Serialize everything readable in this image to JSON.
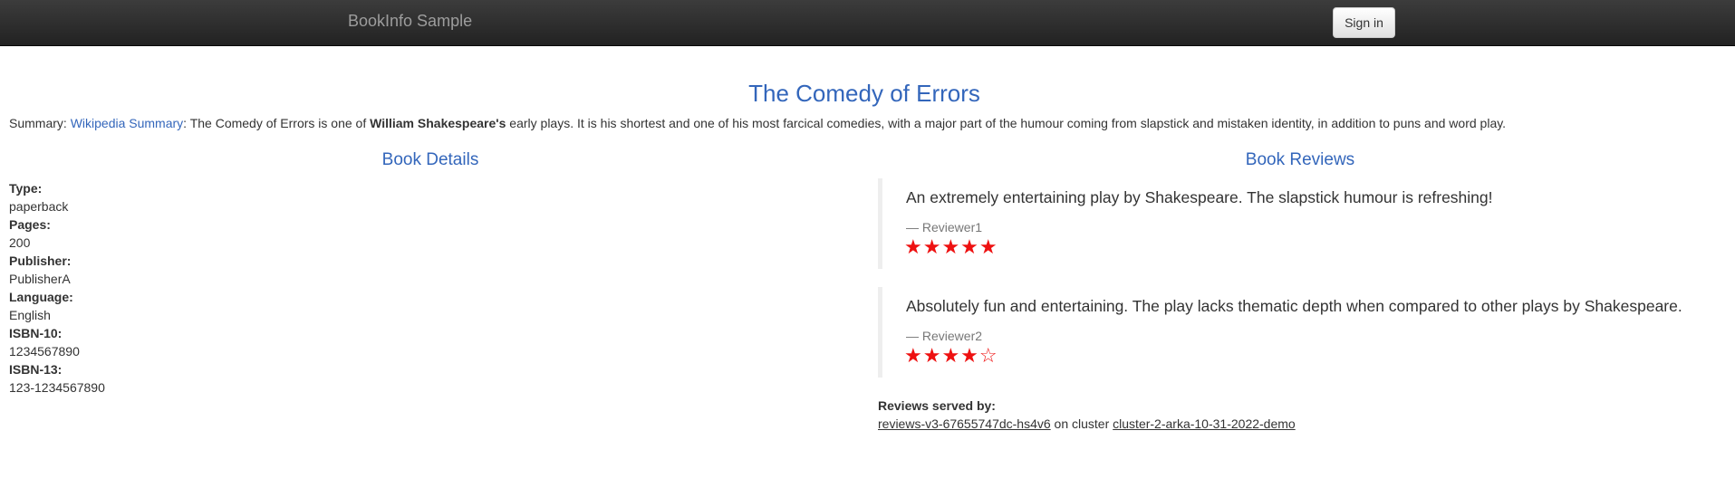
{
  "navbar": {
    "brand": "BookInfo Sample",
    "signin_label": "Sign in"
  },
  "book": {
    "title": "The Comedy of Errors",
    "summary_prefix": "Summary: ",
    "summary_link": "Wikipedia Summary",
    "summary_mid": ": The Comedy of Errors is one of ",
    "summary_bold": "William Shakespeare's",
    "summary_rest": " early plays. It is his shortest and one of his most farcical comedies, with a major part of the humour coming from slapstick and mistaken identity, in addition to puns and word play."
  },
  "details": {
    "heading": "Book Details",
    "fields": [
      {
        "label": "Type:",
        "value": "paperback"
      },
      {
        "label": "Pages:",
        "value": "200"
      },
      {
        "label": "Publisher:",
        "value": "PublisherA"
      },
      {
        "label": "Language:",
        "value": "English"
      },
      {
        "label": "ISBN-10:",
        "value": "1234567890"
      },
      {
        "label": "ISBN-13:",
        "value": "123-1234567890"
      }
    ]
  },
  "reviews": {
    "heading": "Book Reviews",
    "items": [
      {
        "text": "An extremely entertaining play by Shakespeare. The slapstick humour is refreshing!",
        "reviewer": "— Reviewer1",
        "rating": 5,
        "max_rating": 5,
        "stars": "★★★★★"
      },
      {
        "text": "Absolutely fun and entertaining. The play lacks thematic depth when compared to other plays by Shakespeare.",
        "reviewer": "— Reviewer2",
        "rating": 4,
        "max_rating": 5,
        "stars": "★★★★☆"
      }
    ],
    "star_color": "#ee1111",
    "served_by_label": "Reviews served by:",
    "pod": "reviews-v3-67655747dc-hs4v6",
    "on_cluster": " on cluster ",
    "cluster": "cluster-2-arka-10-31-2022-demo"
  },
  "colors": {
    "accent": "#3366bb",
    "navbar_bg": "#222222"
  }
}
